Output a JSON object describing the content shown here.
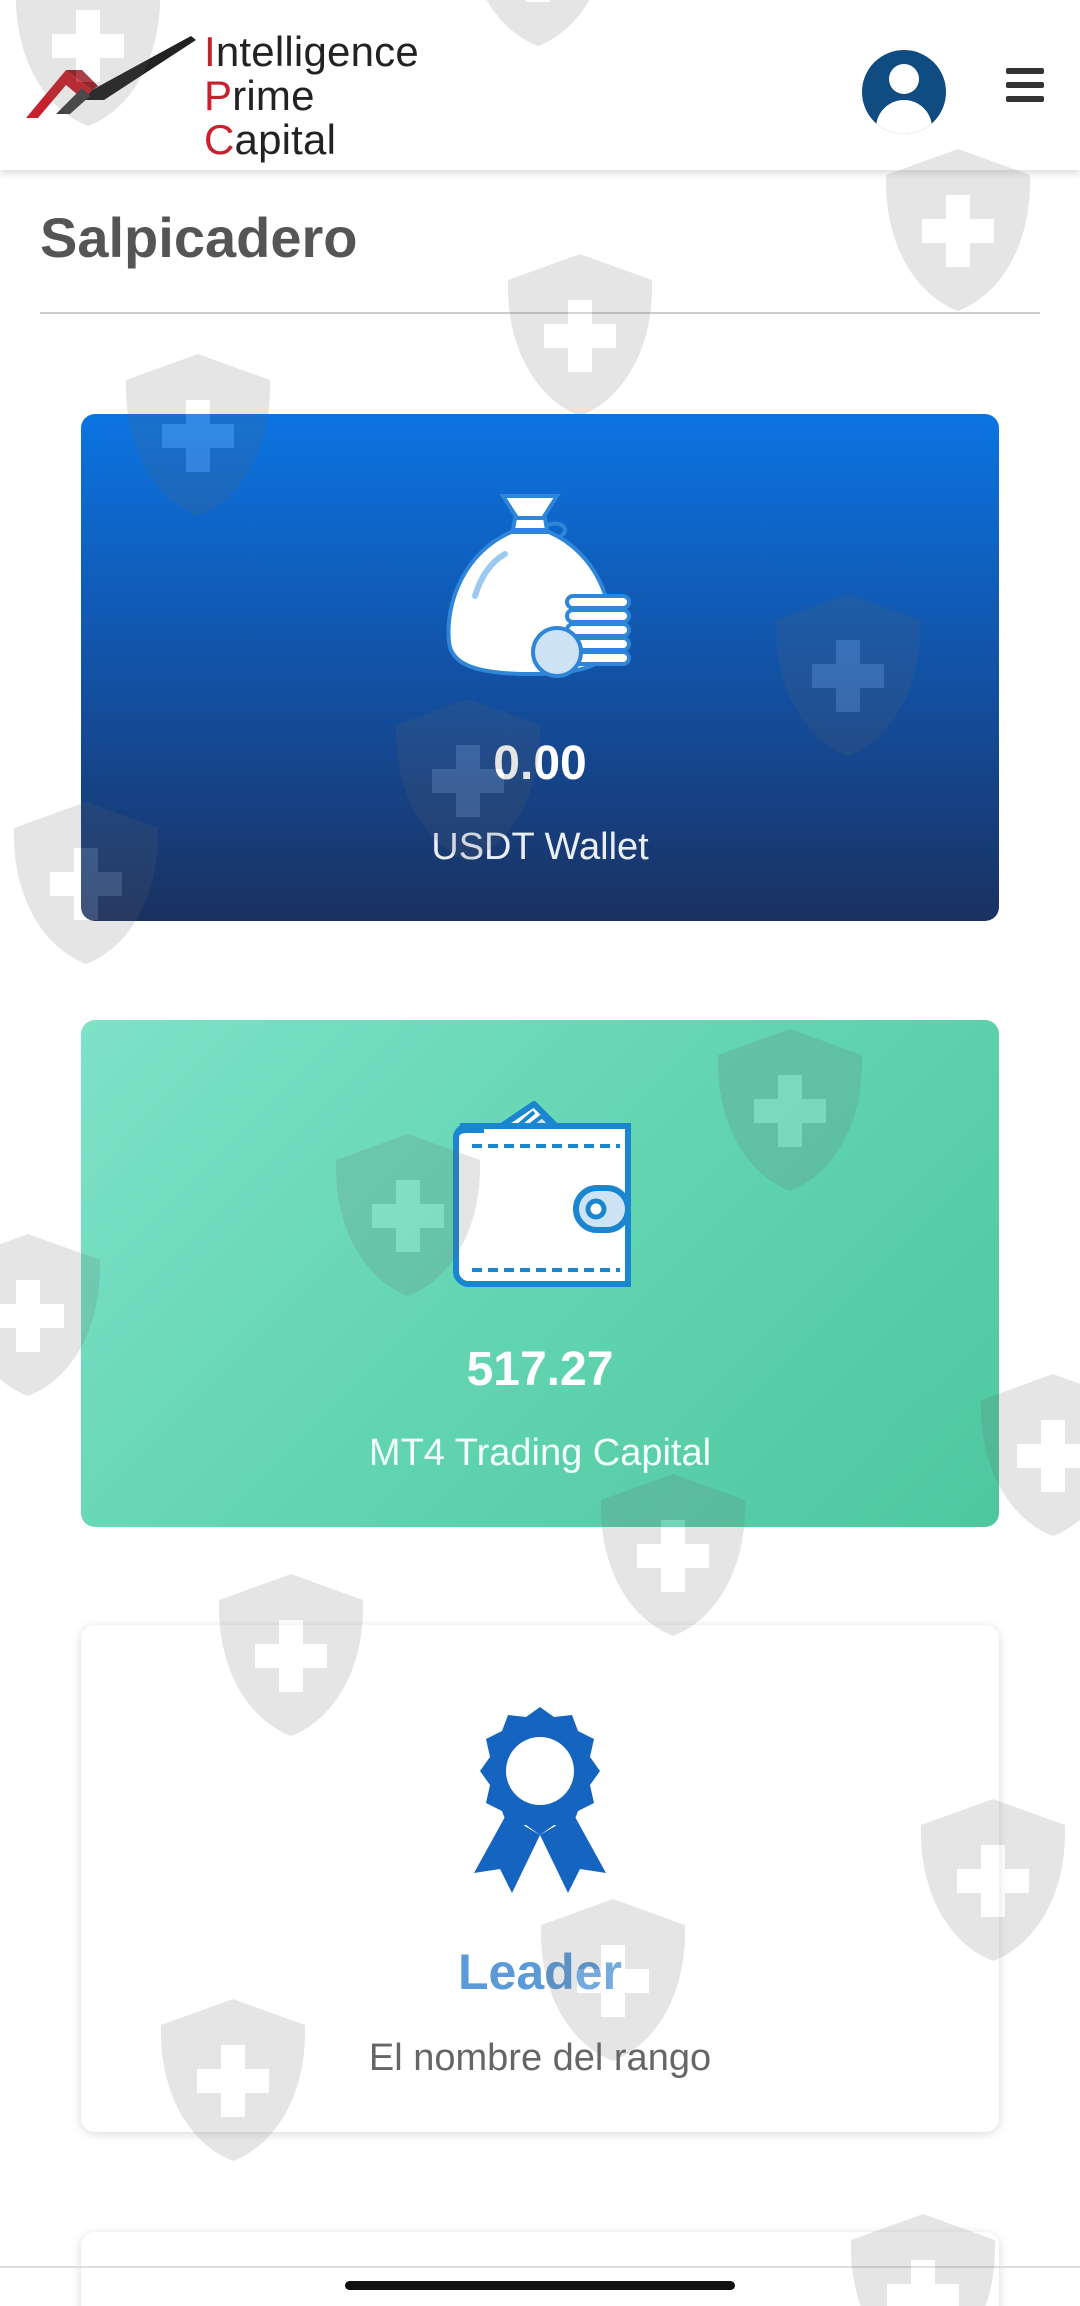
{
  "header": {
    "logo_line1_initial": "I",
    "logo_line1_rest": "ntelligence",
    "logo_line2_initial": "P",
    "logo_line2_mid": "rime ",
    "logo_line2_initial2": "C",
    "logo_line2_rest": "apital",
    "icons": {
      "account": "user-circle-icon",
      "menu": "hamburger-menu-icon"
    }
  },
  "page": {
    "title": "Salpicadero"
  },
  "cards": [
    {
      "value": "0.00",
      "label": "USDT Wallet",
      "icon": "money-bag-icon"
    },
    {
      "value": "517.27",
      "label": "MT4 Trading Capital",
      "icon": "wallet-icon"
    },
    {
      "value": "Leader",
      "label": "El nombre del rango",
      "icon": "award-ribbon-icon"
    }
  ],
  "colors": {
    "brand_red": "#c8202c",
    "header_icon_blue": "#0f4c81",
    "card_blue_top": "#0b74e2",
    "card_blue_bottom": "#1a3160",
    "card_green": "#62d4b1",
    "rank_blue": "#5b9ad9",
    "award_icon": "#1565c0"
  }
}
